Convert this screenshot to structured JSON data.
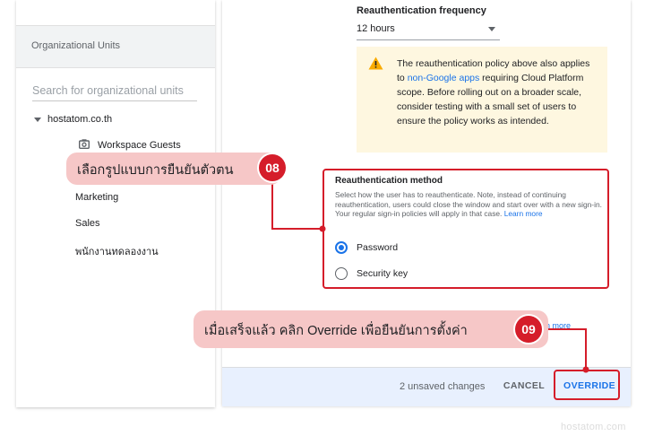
{
  "sidebar": {
    "header": "Organizational Units",
    "search_placeholder": "Search for organizational units",
    "root": "hostatom.co.th",
    "items": [
      "Workspace Guests",
      "Marketing",
      "Sales",
      "พนักงานทดลองงาน"
    ]
  },
  "settings": {
    "freq_title": "Reauthentication frequency",
    "freq_value": "12 hours",
    "warning": {
      "part1": "The reauthentication policy above also applies to ",
      "link": "non-Google apps",
      "part2": " requiring Cloud Platform scope. Before rolling out on a broader scale, consider testing with a small set of users to ensure the policy works as intended."
    },
    "method_title": "Reauthentication method",
    "method_desc": "Select how the user has to reauthenticate. Note, instead of continuing reauthentication, users could close the window and start over with a new sign-in. Your regular sign-in policies will apply in that case. ",
    "method_link": "Learn more",
    "options": [
      {
        "label": "Password",
        "selected": true
      },
      {
        "label": "Security key",
        "selected": false
      }
    ],
    "learn_more_partial": "n more"
  },
  "footer": {
    "unsaved": "2 unsaved changes",
    "cancel": "CANCEL",
    "override": "OVERRIDE"
  },
  "annotations": {
    "step8_text": "เลือกรูปแบบการยืนยันตัวตน",
    "step8_num": "08",
    "step9_text": "เมื่อเสร็จแล้ว คลิก Override เพื่อยืนยันการตั้งค่า",
    "step9_num": "09",
    "color": "#d51d2a",
    "callout_bg": "#f6c7c7"
  },
  "watermark": "hostatom.com"
}
